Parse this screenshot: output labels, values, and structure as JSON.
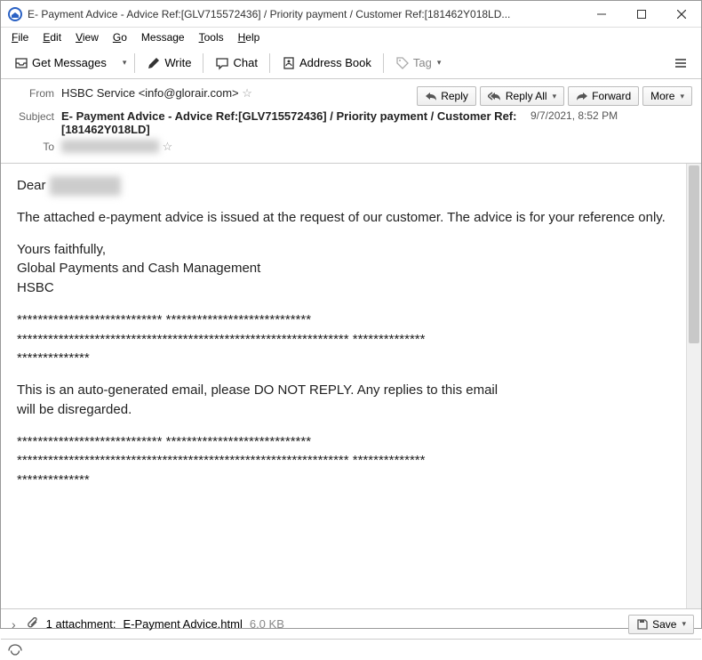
{
  "window": {
    "title": "E- Payment Advice - Advice Ref:[GLV715572436] / Priority payment / Customer Ref:[181462Y018LD..."
  },
  "menubar": {
    "file": "File",
    "edit": "Edit",
    "view": "View",
    "go": "Go",
    "message": "Message",
    "tools": "Tools",
    "help": "Help"
  },
  "toolbar": {
    "get_messages": "Get Messages",
    "write": "Write",
    "chat": "Chat",
    "address_book": "Address Book",
    "tag": "Tag"
  },
  "header": {
    "from_label": "From",
    "from_value": "HSBC Service <info@glorair.com>",
    "subject_label": "Subject",
    "subject_value": "E- Payment Advice - Advice Ref:[GLV715572436] / Priority payment / Customer Ref:[181462Y018LD]",
    "to_label": "To",
    "to_value": "redacted@example",
    "date": "9/7/2021, 8:52 PM",
    "reply": "Reply",
    "reply_all": "Reply All",
    "forward": "Forward",
    "more": "More"
  },
  "body": {
    "greeting": "Dear ",
    "greeting_name": "redacted",
    "p1": "The attached e-payment advice is issued at the request of our customer. The advice is for your reference only.",
    "p2a": "Yours faithfully,",
    "p2b": "Global Payments and Cash Management",
    "p2c": "HSBC",
    "sep1a": "**************************** ****************************",
    "sep1b": "**************************************************************** **************",
    "sep1c": "**************",
    "p3": "This is an auto-generated email, please DO NOT REPLY. Any replies to this email will be disregarded.",
    "sep2a": "**************************** ****************************",
    "sep2b": "**************************************************************** **************",
    "sep2c": "**************"
  },
  "attachment": {
    "count_label": "1 attachment:",
    "filename": "E-Payment Advice.html",
    "size": "6.0 KB",
    "save": "Save"
  }
}
